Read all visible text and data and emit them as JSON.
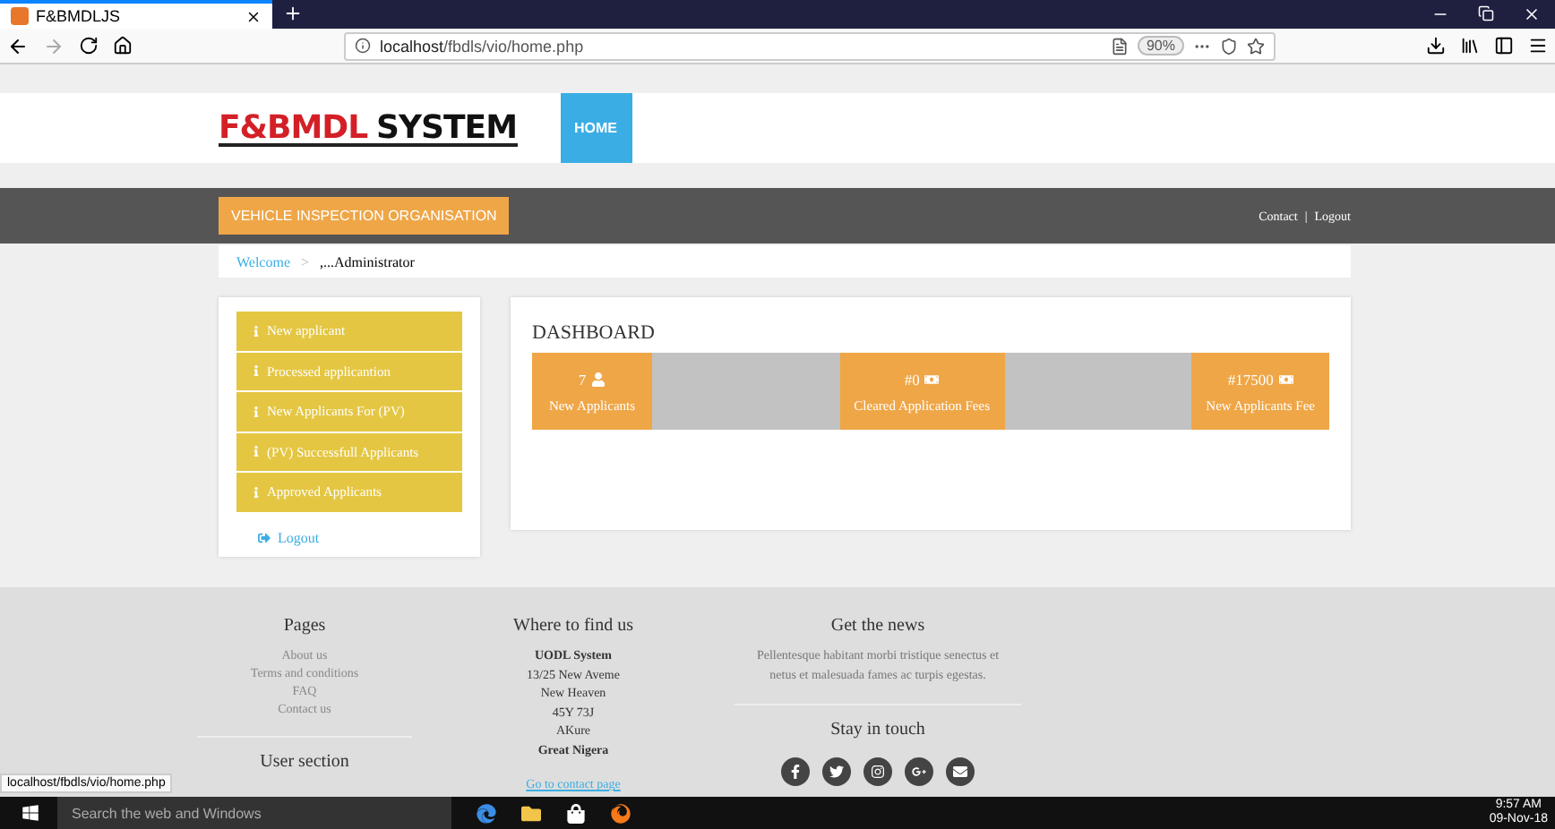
{
  "browser": {
    "tab_title": "F&BMDLJS",
    "url_host": "localhost",
    "url_path": "/fbdls/vio/home.php",
    "zoom": "90%",
    "status_url": "localhost/fbdls/vio/home.php"
  },
  "header": {
    "logo_main": "F&BMDL",
    "logo_second": "SYSTEM",
    "nav": [
      {
        "label": "HOME",
        "selected": true
      }
    ]
  },
  "topbar": {
    "org_button": "VEHICLE INSPECTION ORGANISATION",
    "links": [
      "Contact",
      "Logout"
    ],
    "separator": "|"
  },
  "breadcrumb": {
    "link": "Welcome",
    "separator": ">",
    "current": ",...Administrator"
  },
  "sidebar": {
    "items": [
      {
        "label": "New applicant"
      },
      {
        "label": "Processed applicantion"
      },
      {
        "label": "New Applicants For (PV)"
      },
      {
        "label": "(PV) Successfull Applicants"
      },
      {
        "label": "Approved Applicants"
      }
    ],
    "logout": "Logout"
  },
  "dashboard": {
    "title": "DASHBOARD",
    "stats": [
      {
        "kind": "user",
        "value": "7",
        "label": "New Applicants"
      },
      {
        "kind": "money",
        "value": "#0",
        "label": "Cleared Application Fees"
      },
      {
        "kind": "money",
        "value": "#17500",
        "label": "New Applicants Fee"
      }
    ]
  },
  "footer": {
    "pages": {
      "title": "Pages",
      "links": [
        "About us",
        "Terms and conditions",
        "FAQ",
        "Contact us"
      ]
    },
    "user_section": "User section",
    "find": {
      "title": "Where to find us",
      "lines": [
        {
          "text": "UODL System",
          "bold": true
        },
        {
          "text": "13/25 New Aveme",
          "bold": false
        },
        {
          "text": "New Heaven",
          "bold": false
        },
        {
          "text": "45Y 73J",
          "bold": false
        },
        {
          "text": "AKure",
          "bold": false
        },
        {
          "text": "Great Nigera",
          "bold": true
        }
      ],
      "link": "Go to contact page"
    },
    "news": {
      "title": "Get the news",
      "text": "Pellentesque habitant morbi tristique senectus et netus et malesuada fames ac turpis egestas.",
      "touch": "Stay in touch",
      "social": [
        {
          "kind": "facebook"
        },
        {
          "kind": "twitter"
        },
        {
          "kind": "instagram"
        },
        {
          "kind": "googleplus"
        },
        {
          "kind": "mail"
        }
      ]
    }
  },
  "taskbar": {
    "search": "Search the web and Windows",
    "time": "9:57 AM",
    "date": "09-Nov-18"
  }
}
